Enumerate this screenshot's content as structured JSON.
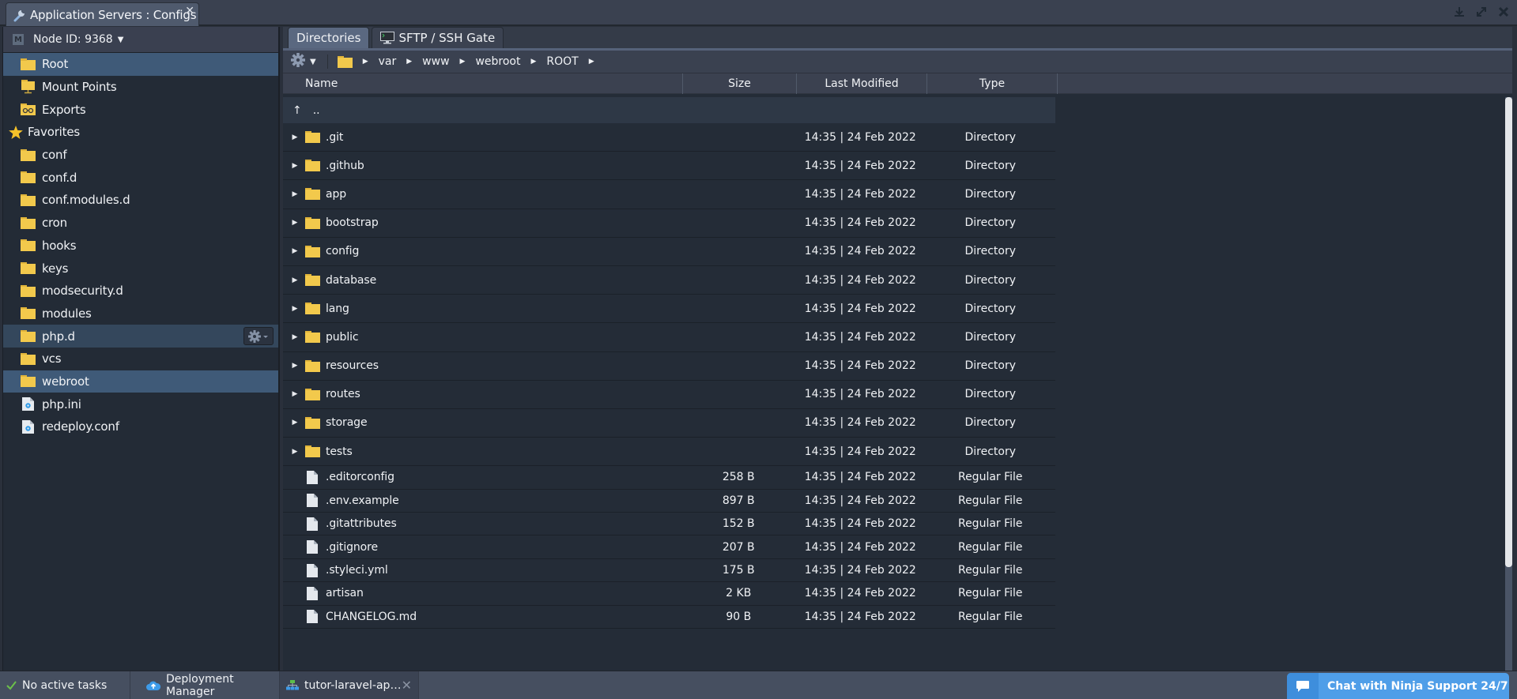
{
  "window": {
    "title": "Application Servers : Configs",
    "controls": [
      "download-icon",
      "expand-icon",
      "close-icon"
    ]
  },
  "sidebar": {
    "node_label": "Node ID: 9368",
    "top_items": [
      {
        "label": "Root",
        "icon": "folder-icon",
        "selected": true
      },
      {
        "label": "Mount Points",
        "icon": "mount-folder-icon"
      },
      {
        "label": "Exports",
        "icon": "export-folder-icon"
      }
    ],
    "favorites_label": "Favorites",
    "favorites": [
      {
        "label": "conf",
        "icon": "folder-icon"
      },
      {
        "label": "conf.d",
        "icon": "folder-icon"
      },
      {
        "label": "conf.modules.d",
        "icon": "folder-icon"
      },
      {
        "label": "cron",
        "icon": "folder-icon"
      },
      {
        "label": "hooks",
        "icon": "folder-icon"
      },
      {
        "label": "keys",
        "icon": "folder-icon"
      },
      {
        "label": "modsecurity.d",
        "icon": "folder-icon"
      },
      {
        "label": "modules",
        "icon": "folder-icon"
      },
      {
        "label": "php.d",
        "icon": "folder-icon",
        "hover": true
      },
      {
        "label": "vcs",
        "icon": "folder-icon"
      },
      {
        "label": "webroot",
        "icon": "folder-icon",
        "selected": true
      },
      {
        "label": "php.ini",
        "icon": "config-file-icon"
      },
      {
        "label": "redeploy.conf",
        "icon": "config-file-icon"
      }
    ]
  },
  "main": {
    "tabs": [
      {
        "label": "Directories",
        "active": true
      },
      {
        "label": "SFTP / SSH Gate",
        "active": false
      }
    ],
    "breadcrumb": [
      "var",
      "www",
      "webroot",
      "ROOT"
    ],
    "columns": {
      "name": "Name",
      "size": "Size",
      "modified": "Last Modified",
      "type": "Type"
    },
    "up_label": "..",
    "rows": [
      {
        "name": ".git",
        "size": "",
        "modified": "14:35 | 24 Feb 2022",
        "type": "Directory",
        "kind": "dir"
      },
      {
        "name": ".github",
        "size": "",
        "modified": "14:35 | 24 Feb 2022",
        "type": "Directory",
        "kind": "dir"
      },
      {
        "name": "app",
        "size": "",
        "modified": "14:35 | 24 Feb 2022",
        "type": "Directory",
        "kind": "dir"
      },
      {
        "name": "bootstrap",
        "size": "",
        "modified": "14:35 | 24 Feb 2022",
        "type": "Directory",
        "kind": "dir"
      },
      {
        "name": "config",
        "size": "",
        "modified": "14:35 | 24 Feb 2022",
        "type": "Directory",
        "kind": "dir"
      },
      {
        "name": "database",
        "size": "",
        "modified": "14:35 | 24 Feb 2022",
        "type": "Directory",
        "kind": "dir"
      },
      {
        "name": "lang",
        "size": "",
        "modified": "14:35 | 24 Feb 2022",
        "type": "Directory",
        "kind": "dir"
      },
      {
        "name": "public",
        "size": "",
        "modified": "14:35 | 24 Feb 2022",
        "type": "Directory",
        "kind": "dir"
      },
      {
        "name": "resources",
        "size": "",
        "modified": "14:35 | 24 Feb 2022",
        "type": "Directory",
        "kind": "dir"
      },
      {
        "name": "routes",
        "size": "",
        "modified": "14:35 | 24 Feb 2022",
        "type": "Directory",
        "kind": "dir"
      },
      {
        "name": "storage",
        "size": "",
        "modified": "14:35 | 24 Feb 2022",
        "type": "Directory",
        "kind": "dir"
      },
      {
        "name": "tests",
        "size": "",
        "modified": "14:35 | 24 Feb 2022",
        "type": "Directory",
        "kind": "dir"
      },
      {
        "name": ".editorconfig",
        "size": "258 B",
        "modified": "14:35 | 24 Feb 2022",
        "type": "Regular File",
        "kind": "file"
      },
      {
        "name": ".env.example",
        "size": "897 B",
        "modified": "14:35 | 24 Feb 2022",
        "type": "Regular File",
        "kind": "file"
      },
      {
        "name": ".gitattributes",
        "size": "152 B",
        "modified": "14:35 | 24 Feb 2022",
        "type": "Regular File",
        "kind": "file"
      },
      {
        "name": ".gitignore",
        "size": "207 B",
        "modified": "14:35 | 24 Feb 2022",
        "type": "Regular File",
        "kind": "file"
      },
      {
        "name": ".styleci.yml",
        "size": "175 B",
        "modified": "14:35 | 24 Feb 2022",
        "type": "Regular File",
        "kind": "file"
      },
      {
        "name": "artisan",
        "size": "2 KB",
        "modified": "14:35 | 24 Feb 2022",
        "type": "Regular File",
        "kind": "file"
      },
      {
        "name": "CHANGELOG.md",
        "size": "90 B",
        "modified": "14:35 | 24 Feb 2022",
        "type": "Regular File",
        "kind": "file"
      }
    ],
    "scroll_position": 0
  },
  "taskbar": {
    "tasks_label": "No active tasks",
    "deployment_label": "Deployment Manager",
    "env_label": "tutor-laravel-ap…",
    "chat_label": "Chat with Ninja Support 24/7"
  },
  "colors": {
    "accent_selected": "#3f5a78",
    "folder": "#f2c94c",
    "chat": "#4f9ee8",
    "check": "#6cc04a"
  }
}
